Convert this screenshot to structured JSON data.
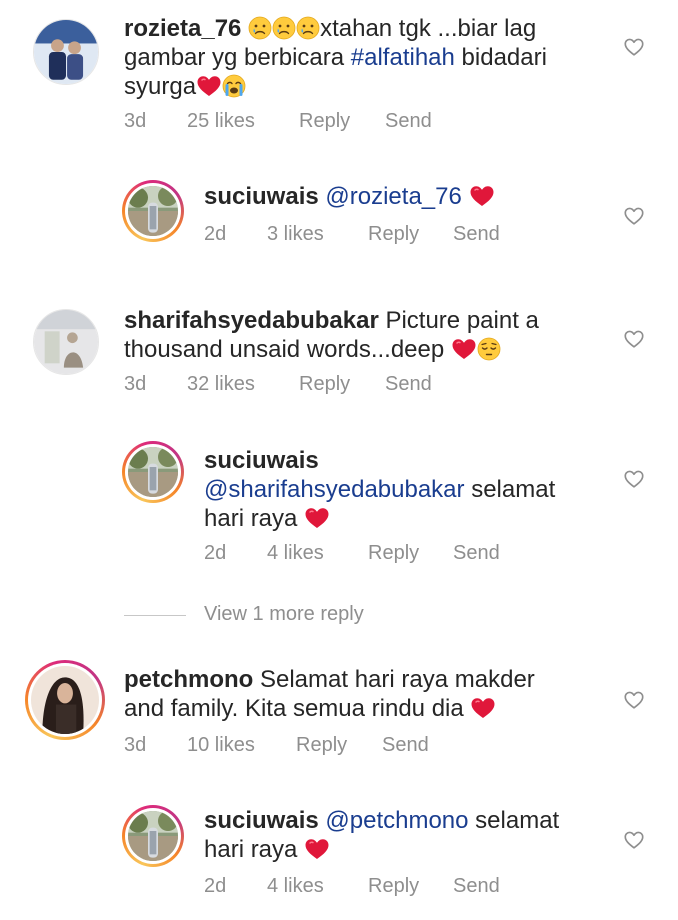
{
  "icons": {
    "like": "heart-outline-icon",
    "sad": "sad-face-emoji",
    "crying": "loudly-crying-face-emoji",
    "pensive": "pensive-face-emoji",
    "heart": "red-heart-emoji"
  },
  "colors": {
    "mention": "#1a3d8f",
    "meta": "#8e8e8e",
    "text": "#262626"
  },
  "comments": [
    {
      "username": "rozieta_76",
      "text_a": "xtahan tgk ...biar lag",
      "text_b": "gambar yg berbicara ",
      "hashtag": "#alfatihah",
      "text_c": " bidadari",
      "text_d": "syurga",
      "time": "3d",
      "likes": "25 likes",
      "reply": "Reply",
      "send": "Send"
    },
    {
      "username": "suciuwais",
      "mention": "@rozieta_76",
      "time": "2d",
      "likes": "3 likes",
      "reply": "Reply",
      "send": "Send"
    },
    {
      "username": "sharifahsyedabubakar",
      "text_a": " Picture paint a",
      "text_b": "thousand unsaid words...deep ",
      "time": "3d",
      "likes": "32 likes",
      "reply": "Reply",
      "send": "Send"
    },
    {
      "username": "suciuwais",
      "mention": "@sharifahsyedabubakar",
      "text_a": " selamat",
      "text_b": "hari raya ",
      "time": "2d",
      "likes": "4 likes",
      "reply": "Reply",
      "send": "Send"
    },
    {
      "username": "petchmono",
      "text_a": " Selamat hari raya makder",
      "text_b": "and family. Kita semua rindu dia ",
      "time": "3d",
      "likes": "10 likes",
      "reply": "Reply",
      "send": "Send"
    },
    {
      "username": "suciuwais",
      "mention": "@petchmono",
      "text_a": " selamat",
      "text_b": "hari raya ",
      "time": "2d",
      "likes": "4 likes",
      "reply": "Reply",
      "send": "Send"
    }
  ],
  "view_more": "View 1 more reply"
}
